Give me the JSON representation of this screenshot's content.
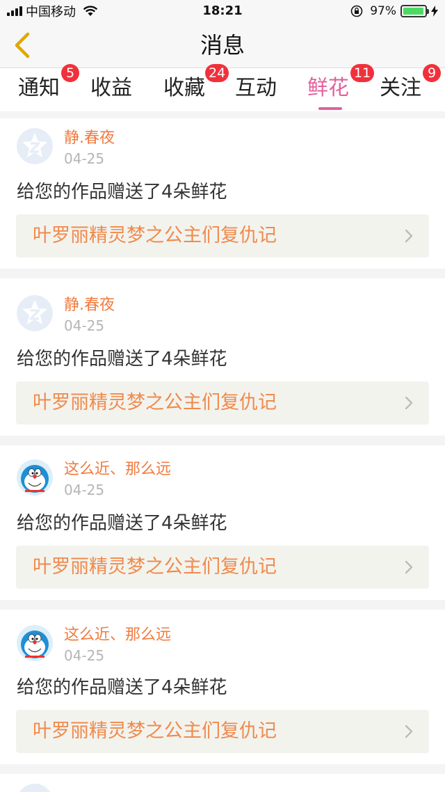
{
  "status_bar": {
    "carrier": "中国移动",
    "time": "18:21",
    "battery": "97%",
    "battery_level": 0.97,
    "icons": [
      "signal-icon",
      "wifi-icon",
      "orientation-lock-icon",
      "battery-icon",
      "charging-icon"
    ]
  },
  "nav": {
    "title": "消息",
    "back_icon": "chevron-left-icon"
  },
  "tabs": [
    {
      "label": "通知",
      "badge": "5"
    },
    {
      "label": "收益",
      "badge": ""
    },
    {
      "label": "收藏",
      "badge": "24"
    },
    {
      "label": "互动",
      "badge": ""
    },
    {
      "label": "鲜花",
      "badge": "11",
      "active": true
    },
    {
      "label": "关注",
      "badge": "9"
    }
  ],
  "colors": {
    "accent": "#e2609d",
    "badge": "#f0313c",
    "username": "#f07b3f",
    "work_title": "#f08a4c"
  },
  "messages": [
    {
      "avatar": "qq-default-avatar",
      "username": "静.春夜",
      "date": "04-25",
      "text": "给您的作品赠送了4朵鲜花",
      "work": "叶罗丽精灵梦之公主们复仇记"
    },
    {
      "avatar": "qq-default-avatar",
      "username": "静.春夜",
      "date": "04-25",
      "text": "给您的作品赠送了4朵鲜花",
      "work": "叶罗丽精灵梦之公主们复仇记"
    },
    {
      "avatar": "doraemon-avatar",
      "username": "这么近、那么远",
      "date": "04-25",
      "text": "给您的作品赠送了4朵鲜花",
      "work": "叶罗丽精灵梦之公主们复仇记"
    },
    {
      "avatar": "doraemon-avatar",
      "username": "这么近、那么远",
      "date": "04-25",
      "text": "给您的作品赠送了4朵鲜花",
      "work": "叶罗丽精灵梦之公主们复仇记"
    }
  ]
}
